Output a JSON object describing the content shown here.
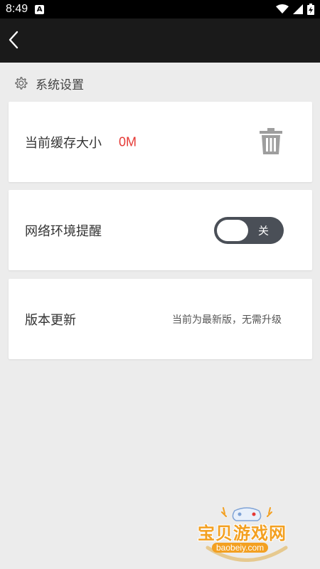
{
  "status_bar": {
    "time": "8:49",
    "notification_icon": "A"
  },
  "app_bar": {
    "back_icon": "chevron-left-icon"
  },
  "section": {
    "title": "系统设置",
    "icon": "gear-icon"
  },
  "cache": {
    "label": "当前缓存大小",
    "value": "0M",
    "value_color": "#e53935",
    "action_icon": "trash-icon"
  },
  "network": {
    "label": "网络环境提醒",
    "toggle_state": "关",
    "toggle_on": false
  },
  "version": {
    "label": "版本更新",
    "status": "当前为最新版，无需升级"
  },
  "watermark": {
    "brand": "宝贝游戏网",
    "url": "baobeiy.com"
  },
  "colors": {
    "accent_red": "#e53935",
    "app_bar": "#1a1a1a",
    "background": "#ececec",
    "toggle_bg": "#4a4f57",
    "watermark": "#f3a021"
  }
}
